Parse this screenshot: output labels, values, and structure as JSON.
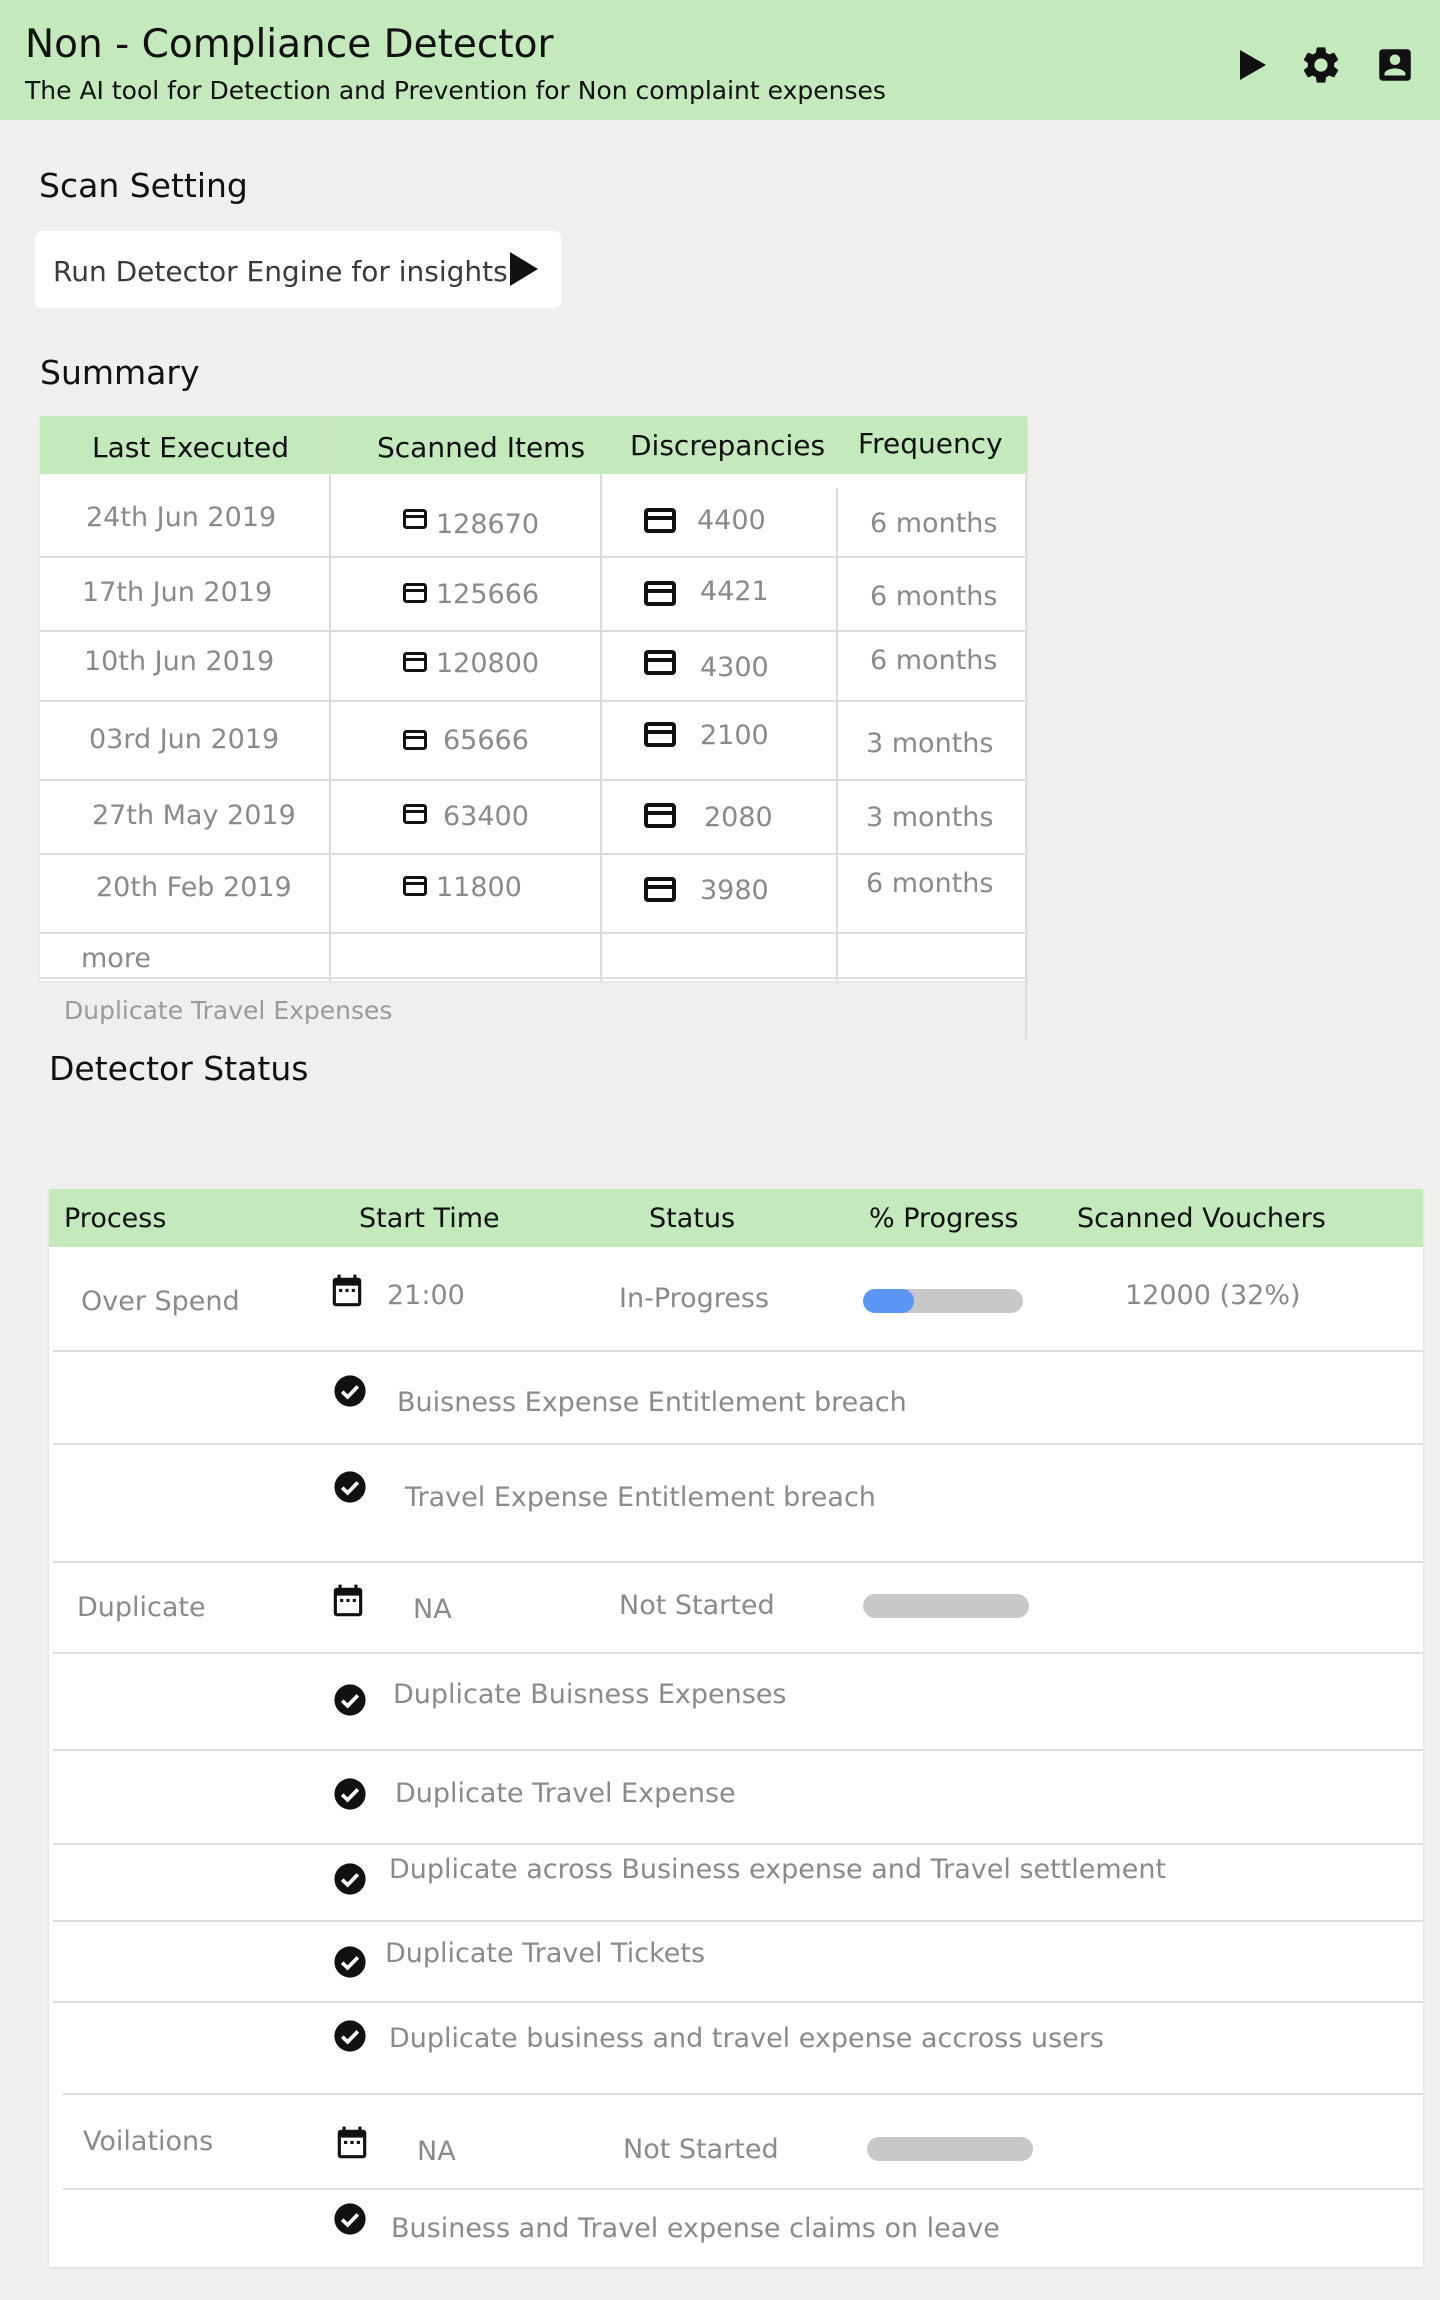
{
  "header": {
    "title": "Non - Compliance Detector",
    "subtitle": "The AI tool for Detection and Prevention for Non complaint expenses",
    "icons": [
      "play-icon",
      "gear-icon",
      "account-box-icon"
    ]
  },
  "scan_setting": {
    "title": "Scan Setting",
    "run_label": "Run Detector Engine for insights"
  },
  "summary": {
    "title": "Summary",
    "columns": [
      "Last Executed",
      "Scanned  Items",
      "Discrepancies",
      "Frequency"
    ],
    "rows": [
      {
        "date": "24th Jun 2019",
        "scanned": "128670",
        "discrepancies": "4400",
        "frequency": "6 months"
      },
      {
        "date": "17th Jun 2019",
        "scanned": "125666",
        "discrepancies": "4421",
        "frequency": "6 months"
      },
      {
        "date": "10th Jun 2019",
        "scanned": "120800",
        "discrepancies": "4300",
        "frequency": "6 months"
      },
      {
        "date": "03rd  Jun 2019",
        "scanned": "65666",
        "discrepancies": "2100",
        "frequency": "3 months"
      },
      {
        "date": "27th May 2019",
        "scanned": "63400",
        "discrepancies": "2080",
        "frequency": "3 months"
      },
      {
        "date": "20th Feb 2019",
        "scanned": "11800",
        "discrepancies": "3980",
        "frequency": "6 months"
      }
    ],
    "more_label": "more",
    "caption": "Duplicate Travel Expenses"
  },
  "detector_status": {
    "title": "Detector Status",
    "columns": [
      "Process",
      "Start Time",
      "Status",
      "% Progress",
      "Scanned Vouchers"
    ],
    "processes": [
      {
        "name": "Over Spend",
        "start_time": "21:00",
        "status": "In-Progress",
        "progress_pct": 32,
        "scanned_vouchers": "12000 (32%)",
        "checks": [
          "Buisness Expense Entitlement breach",
          "Travel Expense Entitlement breach"
        ]
      },
      {
        "name": "Duplicate",
        "start_time": "NA",
        "status": "Not Started",
        "progress_pct": 0,
        "checks": [
          "Duplicate Buisness Expenses",
          "Duplicate Travel Expense",
          "Duplicate across Business expense and Travel settlement",
          "Duplicate Travel Tickets",
          "Duplicate business and travel expense accross users"
        ]
      },
      {
        "name": "Voilations",
        "start_time": "NA",
        "status": "Not Started",
        "progress_pct": 0,
        "checks": [
          "Business and Travel expense claims on leave"
        ]
      }
    ]
  },
  "colors": {
    "header_bg": "#c3e9bd",
    "page_bg": "#efefee",
    "progress_fill": "#5b95f5",
    "progress_track": "#c8c8c8"
  }
}
